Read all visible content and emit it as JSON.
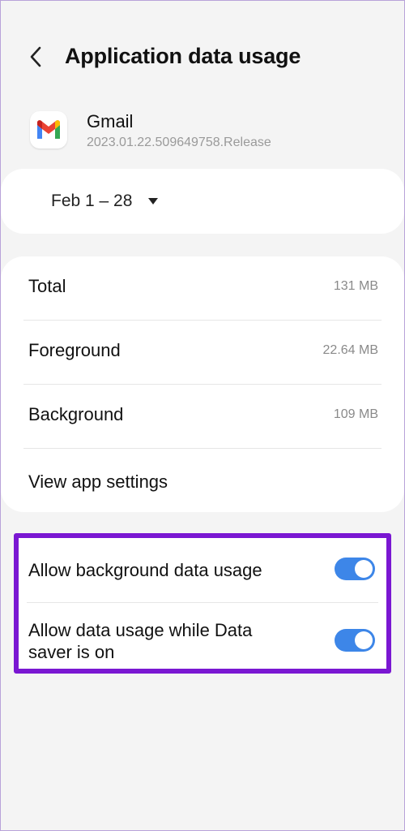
{
  "header": {
    "title": "Application data usage",
    "back_icon": "chevron-left-icon"
  },
  "app": {
    "name": "Gmail",
    "version": "2023.01.22.509649758.Release",
    "icon": "gmail-icon"
  },
  "period": {
    "label": "Feb 1 – 28",
    "icon": "caret-down-icon"
  },
  "stats": [
    {
      "label": "Total",
      "value": "131 MB"
    },
    {
      "label": "Foreground",
      "value": "22.64 MB"
    },
    {
      "label": "Background",
      "value": "109 MB"
    },
    {
      "label": "View app settings"
    }
  ],
  "toggles": [
    {
      "label": "Allow background data usage",
      "on": true
    },
    {
      "label": "Allow data usage while Data saver is on",
      "on": true
    }
  ],
  "colors": {
    "toggle_on": "#3d86e8",
    "highlight": "#7a17d2",
    "background": "#f4f4f4"
  }
}
